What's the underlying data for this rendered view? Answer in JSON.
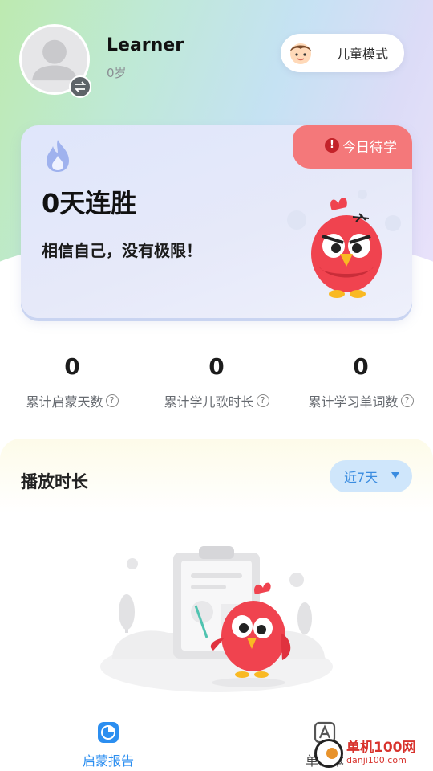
{
  "user": {
    "name": "Learner",
    "age": "0岁"
  },
  "kids_mode": {
    "label": "儿童模式"
  },
  "streak": {
    "pending_label": "今日待学",
    "alert_glyph": "!",
    "count_text": "0天连胜",
    "motto": "相信自己，没有极限！"
  },
  "stats": [
    {
      "value": "0",
      "label": "累计启蒙天数"
    },
    {
      "value": "0",
      "label": "累计学儿歌时长"
    },
    {
      "value": "0",
      "label": "累计学习单词数"
    }
  ],
  "help_glyph": "?",
  "playtime": {
    "title": "播放时长",
    "range_selected": "近7天"
  },
  "bottom_nav": {
    "items": [
      {
        "label": "启蒙报告",
        "icon": "pie-chart-icon",
        "active": true
      },
      {
        "label": "单词本",
        "icon": "letter-a-book-icon",
        "active": false
      }
    ]
  },
  "watermark": {
    "name": "单机100网",
    "url": "danji100.com"
  },
  "colors": {
    "accent_blue": "#2b8ef0",
    "pending_red": "#f4787a",
    "range_bg": "#cfe6fb"
  }
}
